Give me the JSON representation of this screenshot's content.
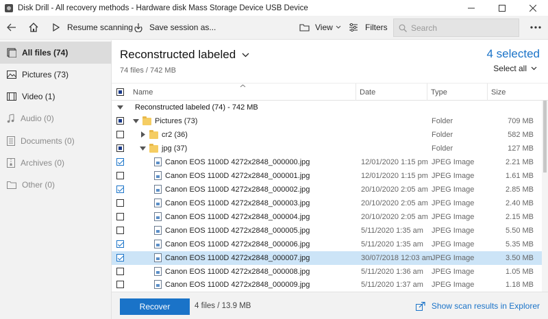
{
  "window": {
    "title": "Disk Drill - All recovery methods - Hardware disk Mass Storage Device USB Device",
    "controls": [
      "minimize",
      "maximize",
      "close"
    ]
  },
  "toolbar": {
    "resume_label": "Resume scanning",
    "save_label": "Save session as...",
    "view_label": "View",
    "filters_label": "Filters",
    "search_placeholder": "Search"
  },
  "sidebar": {
    "items": [
      {
        "label": "All files (74)",
        "icon": "all-files-icon",
        "active": true
      },
      {
        "label": "Pictures (73)",
        "icon": "picture-icon"
      },
      {
        "label": "Video (1)",
        "icon": "video-icon"
      },
      {
        "label": "Audio (0)",
        "icon": "music-icon"
      },
      {
        "label": "Documents (0)",
        "icon": "document-icon"
      },
      {
        "label": "Archives (0)",
        "icon": "archive-icon"
      },
      {
        "label": "Other (0)",
        "icon": "folder-icon"
      }
    ]
  },
  "header": {
    "title": "Reconstructed labeled",
    "subtitle": "74 files / 742 MB",
    "selected": "4 selected",
    "select_all": "Select all"
  },
  "table": {
    "columns": {
      "name": "Name",
      "date": "Date",
      "type": "Type",
      "size": "Size"
    },
    "group": "Reconstructed labeled (74) - 742 MB",
    "rows": [
      {
        "name": "Pictures (73)",
        "date": "",
        "type": "Folder",
        "size": "709 MB",
        "kind": "folder",
        "check": "partial",
        "expand": "down"
      },
      {
        "name": "cr2 (36)",
        "date": "",
        "type": "Folder",
        "size": "582 MB",
        "kind": "folder",
        "check": "none",
        "expand": "right"
      },
      {
        "name": "jpg (37)",
        "date": "",
        "type": "Folder",
        "size": "127 MB",
        "kind": "folder",
        "check": "partial",
        "expand": "down"
      },
      {
        "name": "Canon EOS 1100D 4272x2848_000000.jpg",
        "date": "12/01/2020 1:15 pm",
        "type": "JPEG Image",
        "size": "2.21 MB",
        "kind": "file",
        "check": "checked"
      },
      {
        "name": "Canon EOS 1100D 4272x2848_000001.jpg",
        "date": "12/01/2020 1:15 pm",
        "type": "JPEG Image",
        "size": "1.61 MB",
        "kind": "file",
        "check": "none"
      },
      {
        "name": "Canon EOS 1100D 4272x2848_000002.jpg",
        "date": "20/10/2020 2:05 am",
        "type": "JPEG Image",
        "size": "2.85 MB",
        "kind": "file",
        "check": "checked"
      },
      {
        "name": "Canon EOS 1100D 4272x2848_000003.jpg",
        "date": "20/10/2020 2:05 am",
        "type": "JPEG Image",
        "size": "2.40 MB",
        "kind": "file",
        "check": "none"
      },
      {
        "name": "Canon EOS 1100D 4272x2848_000004.jpg",
        "date": "20/10/2020 2:05 am",
        "type": "JPEG Image",
        "size": "2.15 MB",
        "kind": "file",
        "check": "none"
      },
      {
        "name": "Canon EOS 1100D 4272x2848_000005.jpg",
        "date": "5/11/2020 1:35 am",
        "type": "JPEG Image",
        "size": "5.50 MB",
        "kind": "file",
        "check": "none"
      },
      {
        "name": "Canon EOS 1100D 4272x2848_000006.jpg",
        "date": "5/11/2020 1:35 am",
        "type": "JPEG Image",
        "size": "5.35 MB",
        "kind": "file",
        "check": "checked"
      },
      {
        "name": "Canon EOS 1100D 4272x2848_000007.jpg",
        "date": "30/07/2018 12:03 am",
        "type": "JPEG Image",
        "size": "3.50 MB",
        "kind": "file",
        "check": "checked",
        "selected": true
      },
      {
        "name": "Canon EOS 1100D 4272x2848_000008.jpg",
        "date": "5/11/2020 1:36 am",
        "type": "JPEG Image",
        "size": "1.05 MB",
        "kind": "file",
        "check": "none"
      },
      {
        "name": "Canon EOS 1100D 4272x2848_000009.jpg",
        "date": "5/11/2020 1:37 am",
        "type": "JPEG Image",
        "size": "1.18 MB",
        "kind": "file",
        "check": "none"
      }
    ]
  },
  "bottom": {
    "recover_label": "Recover",
    "recover_info": "4 files / 13.9 MB",
    "scan_link": "Show scan results in Explorer"
  },
  "colors": {
    "accent": "#1a73c8",
    "selected_row": "#cce4f7",
    "folder": "#f5cd63"
  }
}
